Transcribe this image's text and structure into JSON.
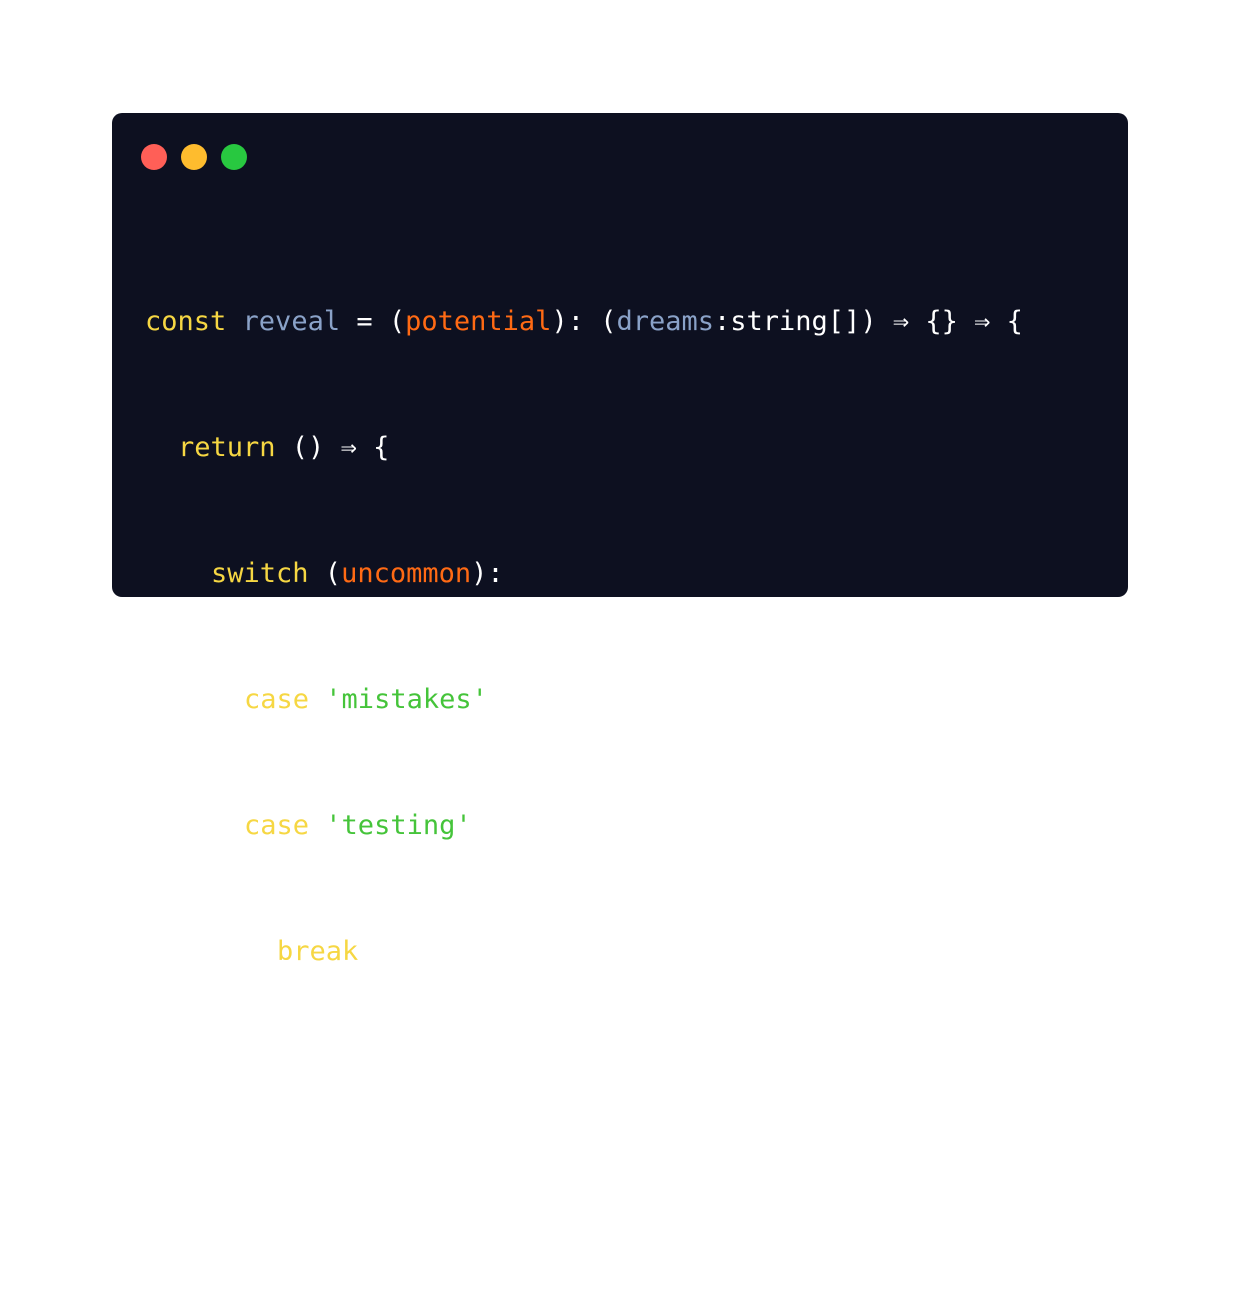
{
  "window": {
    "controls": [
      {
        "name": "close",
        "color": "#ff5f57"
      },
      {
        "name": "minimize",
        "color": "#febc2e"
      },
      {
        "name": "maximize",
        "color": "#28c840"
      }
    ]
  },
  "code": {
    "line1": {
      "kw_const": "const",
      "ident_reveal": "reveal",
      "eq": " = (",
      "param_potential": "potential",
      "mid": "): (",
      "param_dreams": "dreams",
      "type": ":string[]) ⇒ {} ⇒ {"
    },
    "line2": {
      "kw_return": "return",
      "rest": " () ⇒ {"
    },
    "line3": {
      "kw_switch": "switch",
      "open": " (",
      "ident_uncommon": "uncommon",
      "close": "):"
    },
    "line4": {
      "kw_case": "case",
      "str": "'mistakes'",
      "colon": ":"
    },
    "line5": {
      "kw_case": "case",
      "str": "'testing'",
      "colon": ":"
    },
    "line6": {
      "kw_break": "break",
      "semi": ";"
    },
    "line7": {
      "brace": "}"
    },
    "line8": {
      "brace": "}"
    }
  },
  "colors": {
    "background": "#0d1020",
    "keyword": "#f6d743",
    "identifier": "#8aa2c8",
    "argument": "#ff6a14",
    "string": "#45c43a",
    "punctuation": "#ffffff"
  }
}
